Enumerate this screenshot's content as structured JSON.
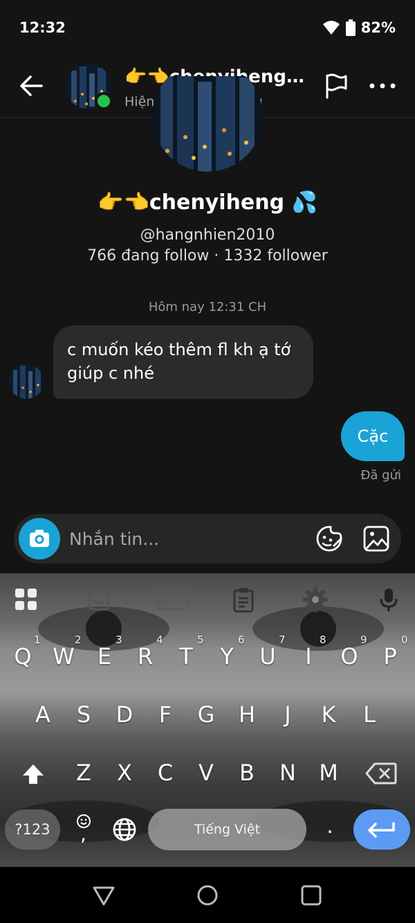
{
  "status": {
    "time": "12:32",
    "battery": "82%"
  },
  "header": {
    "name": "👉👈chenyiheng 💦",
    "subtitle": "Hiện đang hoạt động"
  },
  "profile": {
    "name": "👉👈chenyiheng 💦",
    "handle": "@hangnhien2010",
    "follow_stats": "766 đang follow · 1332 follower"
  },
  "conversation": {
    "timestamp": "Hôm nay 12:31 CH",
    "messages": [
      {
        "from": "other",
        "text": "c muốn kéo thêm fl kh ạ tớ giúp c nhé"
      },
      {
        "from": "me",
        "text": "Cặc"
      }
    ],
    "sent_label": "Đã gửi"
  },
  "composer": {
    "placeholder": "Nhắn tin..."
  },
  "keyboard": {
    "row1": [
      "Q",
      "W",
      "E",
      "R",
      "T",
      "Y",
      "U",
      "I",
      "O",
      "P"
    ],
    "row1_hints": [
      "1",
      "2",
      "3",
      "4",
      "5",
      "6",
      "7",
      "8",
      "9",
      "0"
    ],
    "row2": [
      "A",
      "S",
      "D",
      "F",
      "G",
      "H",
      "J",
      "K",
      "L"
    ],
    "row3": [
      "Z",
      "X",
      "C",
      "V",
      "B",
      "N",
      "M"
    ],
    "symbols_label": "?123",
    "space_label": "Tiếng Việt",
    "period": ".",
    "comma": ",",
    "toolbar": [
      "apps-icon",
      "sticker-icon",
      "gif-icon",
      "clipboard-icon",
      "settings-icon",
      "mic-icon"
    ],
    "gif_label": "GIF"
  },
  "colors": {
    "accent": "#1aa3d6",
    "online": "#27c24c",
    "enter": "#5b9bf4"
  }
}
